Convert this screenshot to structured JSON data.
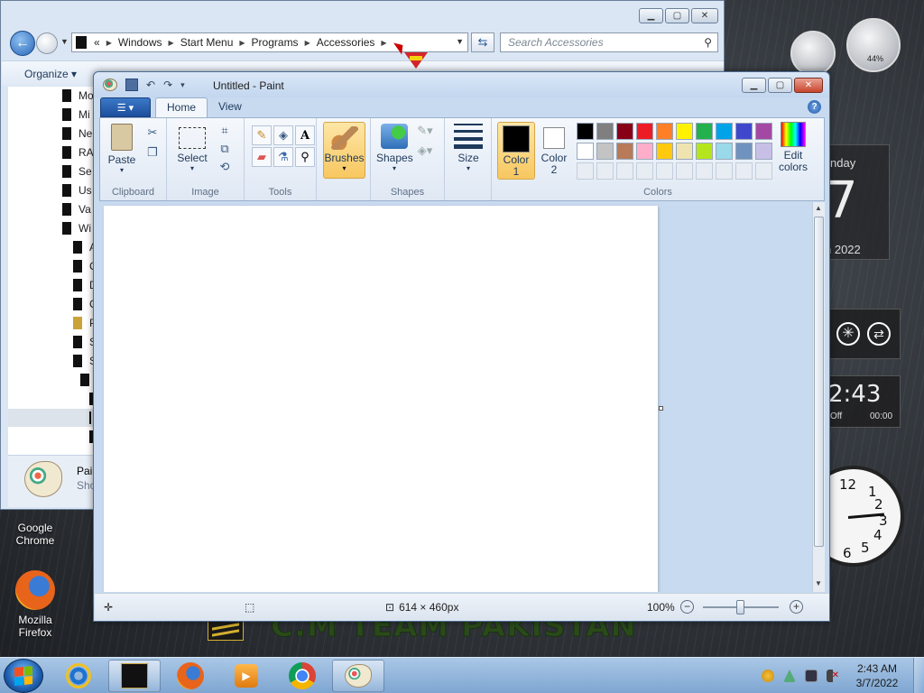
{
  "desktop": {
    "icons": [
      {
        "label": "Google Chrome",
        "icon": "chrome-icon"
      },
      {
        "label": "Mozilla Firefox",
        "icon": "firefox-icon"
      }
    ],
    "banner_text": "C.M TEAM PAKISTAN",
    "calendar": {
      "day_partial": "nday",
      "date_partial": "7",
      "month_partial": "h 2022"
    },
    "gauge_value": "44%",
    "clock_gadget": {
      "time_partial": "2:43",
      "sub_left": "Off",
      "sub_right": "00:00"
    },
    "analog_numbers": [
      "12",
      "1",
      "2",
      "3",
      "4",
      "5",
      "6"
    ]
  },
  "explorer": {
    "breadcrumb": [
      "«",
      "Windows",
      "Start Menu",
      "Programs",
      "Accessories"
    ],
    "search_placeholder": "Search Accessories",
    "organize_label": "Organize",
    "tree_items": [
      "Mo",
      "Mi",
      "Ne",
      "RA",
      "Se",
      "Us",
      "Va",
      "Wi",
      "A",
      "C",
      "D",
      "C",
      "P",
      "S",
      "S",
      "",
      "",
      "",
      ""
    ],
    "status_name": "Pai",
    "status_sub": "Sho"
  },
  "paint": {
    "title": "Untitled - Paint",
    "tabs": {
      "home": "Home",
      "view": "View"
    },
    "ribbon": {
      "clipboard": {
        "label": "Clipboard",
        "paste": "Paste"
      },
      "image": {
        "label": "Image",
        "select": "Select"
      },
      "tools": {
        "label": "Tools"
      },
      "brushes": "Brushes",
      "shapes": {
        "label": "Shapes",
        "shapes_btn": "Shapes"
      },
      "size": "Size",
      "colors": {
        "label": "Colors",
        "color1": "Color 1",
        "color2": "Color 2",
        "edit": "Edit colors",
        "color1_value": "#000000",
        "color2_value": "#ffffff",
        "palette_row1": [
          "#000000",
          "#7f7f7f",
          "#880015",
          "#ed1c24",
          "#ff7f27",
          "#fff200",
          "#22b14c",
          "#00a2e8",
          "#3f48cc",
          "#a349a4"
        ],
        "palette_row2": [
          "#ffffff",
          "#c3c3c3",
          "#b97a57",
          "#ffaec9",
          "#ffc90e",
          "#efe4b0",
          "#b5e61d",
          "#99d9ea",
          "#7092be",
          "#c8bfe7"
        ],
        "custom_slots": 10
      }
    },
    "status": {
      "canvas_size": "614 × 460px",
      "zoom": "100%",
      "zoom_fraction": 0.5
    }
  },
  "taskbar": {
    "pinned": [
      "ie-icon",
      "cm-team-icon",
      "firefox-icon",
      "media-player-icon",
      "chrome-icon",
      "paint-icon"
    ],
    "clock_time": "2:43 AM",
    "clock_date": "3/7/2022"
  }
}
